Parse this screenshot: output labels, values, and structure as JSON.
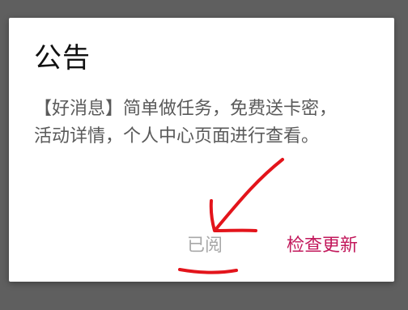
{
  "dialog": {
    "title": "公告",
    "message": "【好消息】简单做任务，免费送卡密，活动详情，个人中心页面进行查看。",
    "buttons": {
      "read_label": "已阅",
      "update_label": "检查更新"
    }
  },
  "colors": {
    "overlay": "#5f5f5f",
    "dialog_bg": "#ffffff",
    "accent": "#c2185b",
    "annotation": "#e3141b"
  }
}
